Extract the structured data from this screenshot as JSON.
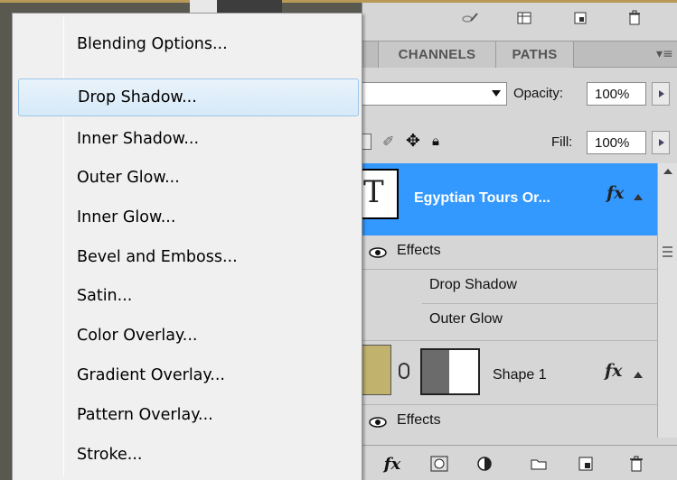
{
  "menu": {
    "items": [
      {
        "label": "Blending Options..."
      },
      {
        "label": "Drop Shadow..."
      },
      {
        "label": "Inner Shadow..."
      },
      {
        "label": "Outer Glow..."
      },
      {
        "label": "Inner Glow..."
      },
      {
        "label": "Bevel and Emboss..."
      },
      {
        "label": "Satin..."
      },
      {
        "label": "Color Overlay..."
      },
      {
        "label": "Gradient Overlay..."
      },
      {
        "label": "Pattern Overlay..."
      },
      {
        "label": "Stroke..."
      }
    ],
    "highlighted_index": 1
  },
  "panel": {
    "tabs": [
      {
        "label": "CHANNELS"
      },
      {
        "label": "PATHS"
      }
    ],
    "opacity_label": "Opacity:",
    "opacity_value": "100%",
    "fill_label": "Fill:",
    "fill_value": "100%",
    "layers": {
      "selected_name": "Egyptian Tours  Or...",
      "fx_glyph": "fx",
      "effects_label": "Effects",
      "effect_drop_shadow": "Drop Shadow",
      "effect_outer_glow": "Outer Glow",
      "shape_name": "Shape 1",
      "shape_fx_glyph": "fx",
      "shape_effects_label": "Effects"
    },
    "bottom_fx_glyph": "fx"
  },
  "colors": {
    "selection_blue": "#3399ff",
    "menu_bg": "#f0f0f0",
    "menu_highlight": "#d6e9f8",
    "panel_bg": "#d6d6d6"
  }
}
